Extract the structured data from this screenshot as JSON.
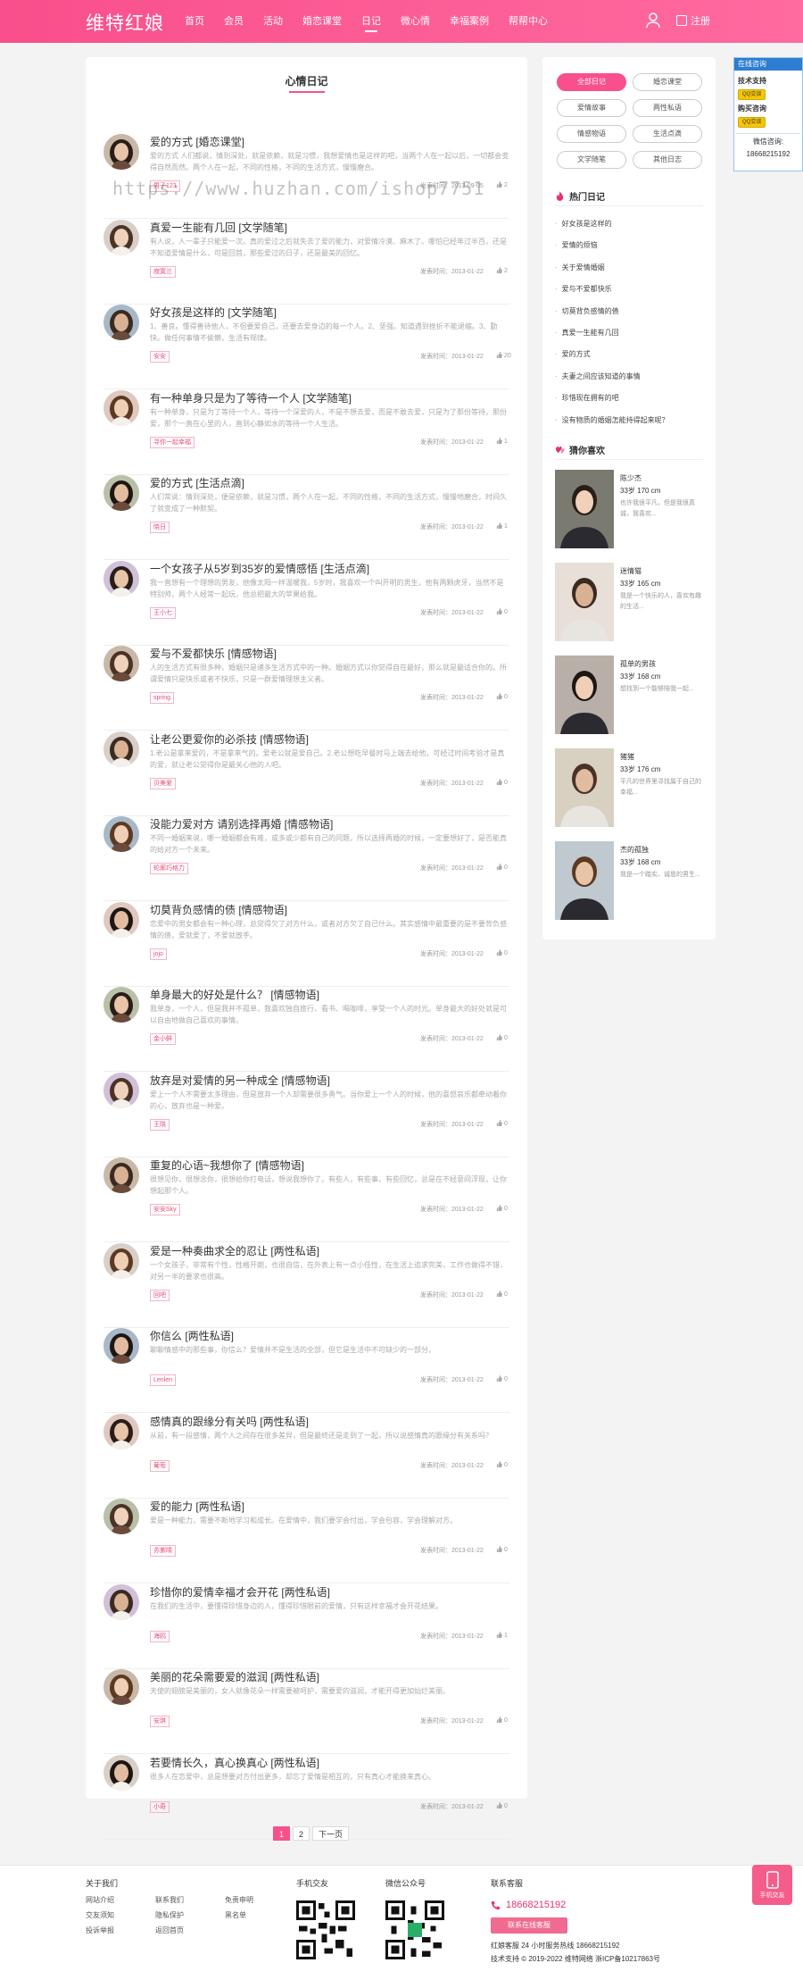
{
  "header": {
    "logo": "维特红娘",
    "nav": [
      "首页",
      "会员",
      "活动",
      "婚恋课堂",
      "日记",
      "微心情",
      "幸福案例",
      "帮帮中心"
    ],
    "active_index": 4,
    "register": "注册"
  },
  "main": {
    "title": "心情日记",
    "watermark": "https://www.huzhan.com/ishop7751",
    "posts": [
      {
        "title": "爱的方式 [婚恋课堂]",
        "excerpt": "爱的方式 人们都说，情到深处，就是依赖，就是习惯，我想爱情也是这样的吧，当两个人在一起以后，一切都会变得自然而然。两个人在一起，不同的性格，不同的生活方式，慢慢磨合。",
        "tag": "男子123",
        "date": "发表时间：2013-09-05",
        "likes": "2"
      },
      {
        "title": "真爱一生能有几回 [文学随笔]",
        "excerpt": "有人说，人一辈子只能爱一次。真的爱过之后就失去了爱的能力，对爱情冷漠、麻木了。哪怕已经年过半百，还是不知道爱情是什么，可是回首，那些爱过的日子，还是最美的回忆。",
        "tag": "寂寞兰",
        "date": "发表时间：2013-01-22",
        "likes": "2"
      },
      {
        "title": "好女孩是这样的 [文学随笔]",
        "excerpt": "1、善良。懂得善待他人，不但要爱自己，还要去爱身边的每一个人。2、坚强。知道遇到挫折不能退缩。3、勤快。做任何事情不偷懒，生活有规律。",
        "tag": "安安",
        "date": "发表时间：2013-01-22",
        "likes": "20"
      },
      {
        "title": "有一种单身只是为了等待一个人 [文学随笔]",
        "excerpt": "有一种单身，只是为了等待一个人，等待一个深爱的人，不是不想去爱，而是不敢去爱，只是为了那份等待，那份爱，那个一直在心里的人，直到心静如水的等待一个人生活。",
        "tag": "寻你一起幸福",
        "date": "发表时间：2013-01-22",
        "likes": "1"
      },
      {
        "title": "爱的方式 [生活点滴]",
        "excerpt": "人们常说：情到深处，便是依赖，就是习惯，两个人在一起，不同的性格，不同的生活方式，慢慢地磨合，时间久了就变成了一种默契。",
        "tag": "晓日",
        "date": "发表时间：2013-01-22",
        "likes": "1"
      },
      {
        "title": "一个女孩子从5岁到35岁的爱情感悟 [生活点滴]",
        "excerpt": "我一直想有一个理想的男友，他像太阳一样温暖我，5岁时，我喜欢一个叫开明的男生，他有两颗虎牙，当然不是特别帅，两个人经常一起玩，他总把最大的苹果给我。",
        "tag": "王小七",
        "date": "发表时间：2013-01-22",
        "likes": "0"
      },
      {
        "title": "爱与不爱都快乐 [情感物语]",
        "excerpt": "人的生活方式有很多种，婚姻只是诸多生活方式中的一种。婚姻方式以你觉得自在最好，那么就是最适合你的。所谓爱情只是快乐或者不快乐，只是一群爱情理想主义者。",
        "tag": "spring",
        "date": "发表时间：2013-01-22",
        "likes": "0"
      },
      {
        "title": "让老公更爱你的必杀技 [情感物语]",
        "excerpt": "1.老公是拿来爱的，不是拿来气的。爱老公就是爱自己。2.老公想吃早餐时马上端去给他，可经过时间考验才是真的爱，就让老公觉得你是最关心他的人吧。",
        "tag": "贝美爱",
        "date": "发表时间：2013-01-22",
        "likes": "0"
      },
      {
        "title": "没能力爱对方 请别选择再婚 [情感物语]",
        "excerpt": "不同一婚姻来说，哪一婚姻都会有难，或多或少都有自己的问题，所以选择再婚的时候，一定要想好了，是否能真的给对方一个未来。",
        "tag": "轮廓巧格力",
        "date": "发表时间：2013-01-22",
        "likes": "0"
      },
      {
        "title": "切莫背负感情的债 [情感物语]",
        "excerpt": "恋爱中的男女都会有一种心理，总觉得欠了对方什么，或者对方欠了自己什么。其实感情中最重要的是不要背负感情的债，爱就爱了，不爱就放手。",
        "tag": "jojo",
        "date": "发表时间：2013-01-22",
        "likes": "0"
      },
      {
        "title": "单身最大的好处是什么？ [情感物语]",
        "excerpt": "我单身，一个人，但是我并不孤单，我喜欢独自旅行、看书、喝咖啡，享受一个人的时光。单身最大的好处就是可以自由地做自己喜欢的事情。",
        "tag": "金小鲜",
        "date": "发表时间：2013-01-22",
        "likes": "0"
      },
      {
        "title": "放弃是对爱情的另一种成全 [情感物语]",
        "excerpt": "爱上一个人不需要太多理由，但是放弃一个人却需要很多勇气。当你爱上一个人的时候，他的喜怒哀乐都牵动着你的心，放弃也是一种爱。",
        "tag": "王晓",
        "date": "发表时间：2013-01-22",
        "likes": "0"
      },
      {
        "title": "重复的心语~我想你了 [情感物语]",
        "excerpt": "很想见你，很想念你，很想给你打电话，想说我想你了。有些人，有些事，有些回忆，总是在不经意间浮现，让你想起那个人。",
        "tag": "安安Sky",
        "date": "发表时间：2013-01-22",
        "likes": "0"
      },
      {
        "title": "爱是一种奏曲求全的忍让 [两性私语]",
        "excerpt": "一个女孩子，非常有个性，性格开朗，也很自信，在外表上有一点小任性，在生活上追求完美，工作也做得不错，对另一半的要求也很高。",
        "tag": "回吧",
        "date": "发表时间：2013-01-22",
        "likes": "0"
      },
      {
        "title": "你信么 [两性私语]",
        "excerpt": "聊聊情感中的那些事，你信么？爱情并不是生活的全部，但它是生活中不可缺少的一部分。",
        "tag": "Lenlen",
        "date": "发表时间：2013-01-22",
        "likes": "0"
      },
      {
        "title": "感情真的跟缘分有关吗 [两性私语]",
        "excerpt": "从前，有一段感情，两个人之间存在很多差异，但是最终还是走到了一起，所以说感情真的跟缘分有关系吗？",
        "tag": "葡萄",
        "date": "发表时间：2013-01-22",
        "likes": "0"
      },
      {
        "title": "爱的能力 [两性私语]",
        "excerpt": "爱是一种能力，需要不断地学习和成长。在爱情中，我们要学会付出，学会包容，学会理解对方。",
        "tag": "苏紫晴",
        "date": "发表时间：2013-01-22",
        "likes": "0"
      },
      {
        "title": "珍惜你的爱情幸福才会开花 [两性私语]",
        "excerpt": "在我们的生活中，要懂得珍惜身边的人，懂得珍惜眼前的爱情，只有这样幸福才会开花结果。",
        "tag": "海鸥",
        "date": "发表时间：2013-01-22",
        "likes": "1"
      },
      {
        "title": "美丽的花朵需要爱的滋润 [两性私语]",
        "excerpt": "天使的翅膀是美丽的，女人就像花朵一样需要被呵护，需要爱的滋润，才能开得更加灿烂美丽。",
        "tag": "安琪",
        "date": "发表时间：2013-01-22",
        "likes": "0"
      },
      {
        "title": "若要情长久，真心换真心 [两性私语]",
        "excerpt": "很多人在恋爱中，总是想要对方付出更多，却忘了爱情是相互的，只有真心才能换来真心。",
        "tag": "小奇",
        "date": "发表时间：2013-01-22",
        "likes": "0"
      }
    ]
  },
  "pager": {
    "pages": [
      "1",
      "2"
    ],
    "next": "下一页"
  },
  "sidebar": {
    "categories": [
      "全部日记",
      "婚恋课堂",
      "爱情故事",
      "两性私语",
      "情感物语",
      "生活点滴",
      "文学随笔",
      "其他日志"
    ],
    "hot_title": "热门日记",
    "hot": [
      "好女孩是这样的",
      "爱情的烦恼",
      "关于爱情婚姻",
      "爱与不爱都快乐",
      "切莫背负感情的债",
      "真爱一生能有几回",
      "爱的方式",
      "夫妻之间应该知道的事情",
      "珍惜现在拥有的吧",
      "没有物质的婚姻怎能持得起来呢？"
    ],
    "guess_title": "猜你喜欢",
    "guess": [
      {
        "name": "陈少杰",
        "info": "33岁 170 cm",
        "desc": "也许我很平凡，但是我很真诚，我喜欢..."
      },
      {
        "name": "迷情猫",
        "info": "33岁 165 cm",
        "desc": "我是一个快乐的人，喜欢有趣的生活..."
      },
      {
        "name": "孤单的男孩",
        "info": "33岁 168 cm",
        "desc": "想找到一个能够陪我一起..."
      },
      {
        "name": "猪猪",
        "info": "33岁 176 cm",
        "desc": "平凡的世界里寻找属于自己的幸福..."
      },
      {
        "name": "杰的孤独",
        "info": "33岁 168 cm",
        "desc": "我是一个踏实、诚恳的男生..."
      }
    ]
  },
  "float_widget": {
    "header": "在线咨询",
    "tech": "技术支持",
    "buy": "购买咨询",
    "qq": "QQ交谈",
    "wechat_label": "微信咨询:",
    "wechat": "18668215192"
  },
  "footer": {
    "about_title": "关于我们",
    "links": [
      "网站介绍",
      "联系我们",
      "免责申明",
      "交友须知",
      "隐私保护",
      "黑名单",
      "投诉举报",
      "返回首页"
    ],
    "wechat_friend": "手机交友",
    "wechat_public": "微信公众号",
    "contact_title": "联系客服",
    "phone": "18668215192",
    "contact_btn": "联系在线客服",
    "service": "红娘客服  24 小时服务热线 18668215192",
    "copyright": "技术支持 © 2019-2022 维特网络  浙ICP备10217863号",
    "mobile": "手机交友"
  },
  "colors": {
    "brand": "#f94f8c",
    "tag": "#e84c73"
  }
}
